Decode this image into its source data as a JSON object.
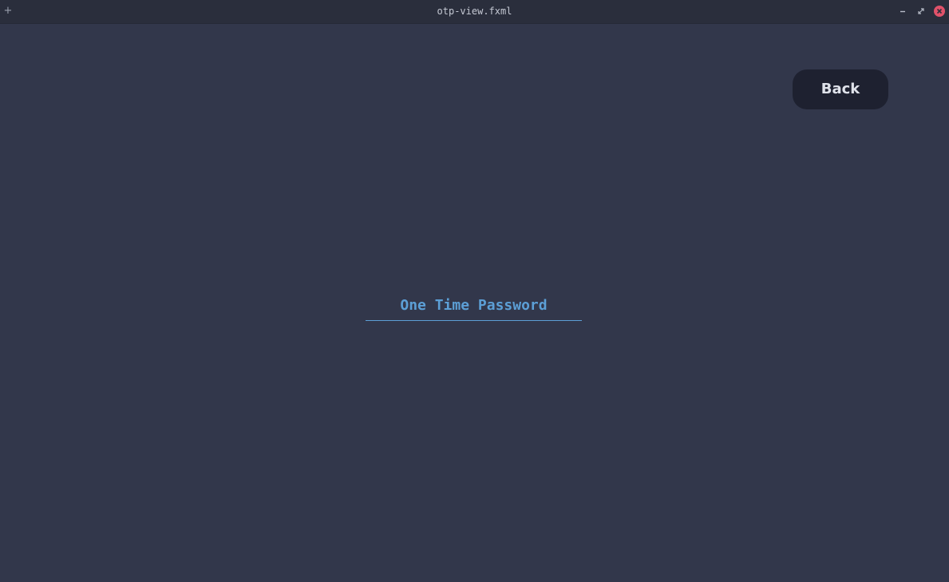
{
  "window": {
    "title": "otp-view.fxml",
    "controls": {
      "pin_icon": "plus-icon",
      "minimize_icon": "minimize-icon",
      "maximize_icon": "restore-icon",
      "close_icon": "close-icon"
    }
  },
  "main": {
    "back_label": "Back",
    "otp_field": {
      "value": "",
      "placeholder": "One Time Password"
    }
  },
  "colors": {
    "background": "#32374b",
    "titlebar": "#2a2e3c",
    "button_bg": "#1e2130",
    "accent": "#5c9fd6",
    "close": "#e0526a"
  }
}
